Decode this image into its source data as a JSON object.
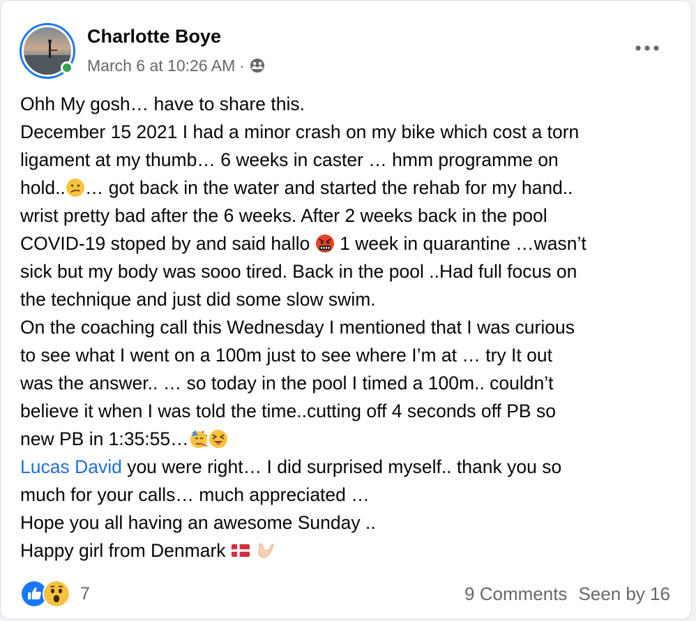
{
  "post": {
    "author": "Charlotte Boye",
    "timestamp": "March 6 at 10:26 AM",
    "separator": "·",
    "audience_icon": "friends-audience-icon",
    "body": {
      "l1": "Ohh My gosh… have to share this.",
      "l2": "December 15 2021 I had a minor crash on my bike which cost a torn",
      "l3": "ligament at my thumb… 6 weeks in caster … hmm programme on",
      "l4a": "hold..",
      "l4b": "… got back in the water and started the rehab for my hand..",
      "l5": "wrist pretty bad after the 6 weeks. After 2 weeks back in the pool",
      "l6a": "COVID-19 stoped by and said hallo",
      "l6b": " 1 week in quarantine …wasn’t",
      "l7": "sick but my body was sooo tired. Back in the pool ..Had full focus on",
      "l8": "the technique and just did some slow swim.",
      "l9": "On the coaching call this Wednesday I mentioned that I was curious",
      "l10": "to see what I went on a 100m just to see where I’m at … try It out",
      "l11": "was the answer.. … so today in the pool I timed a 100m.. couldn’t",
      "l12": "believe it when I was told the time..cutting off 4 seconds off PB so",
      "l13": "new PB in 1:35:55…",
      "l14_mention": "Lucas David",
      "l14": " you were right… I did surprised myself.. thank you so",
      "l15": "much for your calls… much appreciated …",
      "l16": "Hope you all having an awesome Sunday ..",
      "l17": "Happy girl from Denmark"
    }
  },
  "reactions": {
    "icons": [
      "like-reaction-icon",
      "wow-reaction-icon"
    ],
    "count": "7"
  },
  "stats": {
    "comments": "9 Comments",
    "seen": "Seen by 16"
  },
  "colors": {
    "accent": "#1877f2",
    "mention": "#216fdb",
    "secondary_text": "#65676b",
    "online": "#31a24c"
  }
}
